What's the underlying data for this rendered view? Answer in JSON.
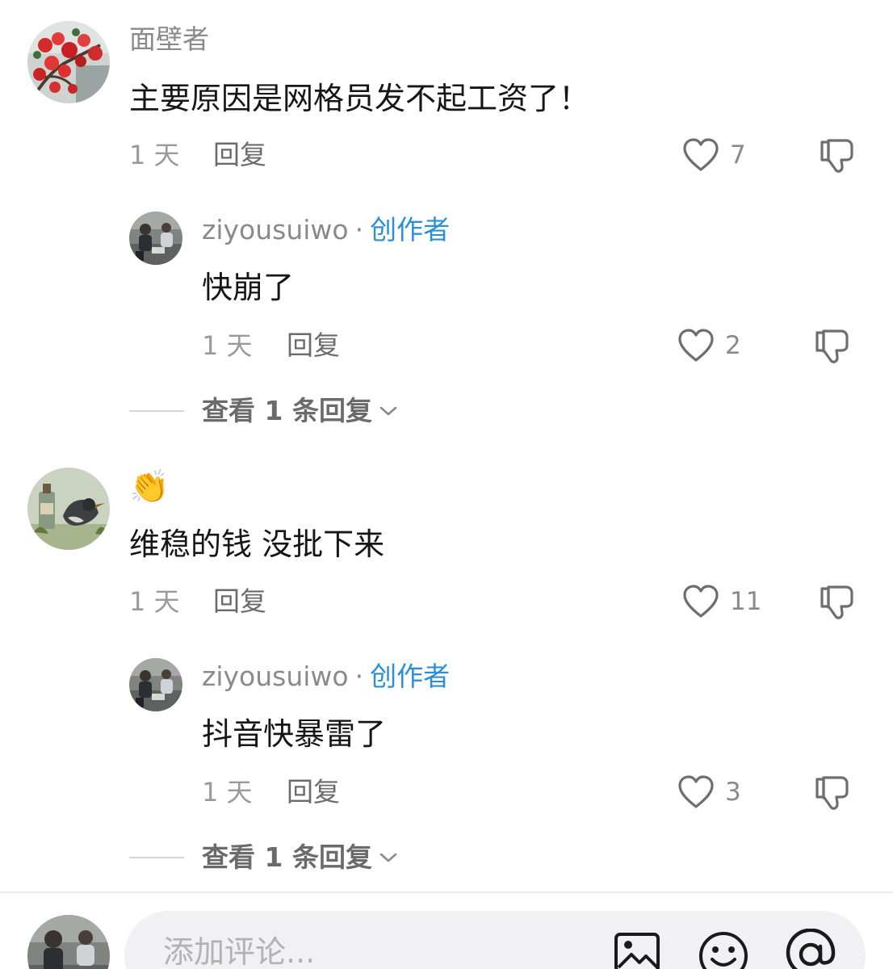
{
  "comments": [
    {
      "username": "面壁者",
      "text": "主要原因是网格员发不起工资了！",
      "time": "1 天",
      "reply_label": "回复",
      "likes": "7",
      "avatar_icon": "red-flowers-avatar",
      "replies": [
        {
          "username": "ziyousuiwo",
          "separator": "·",
          "badge": "创作者",
          "text": "快崩了",
          "time": "1 天",
          "reply_label": "回复",
          "likes": "2",
          "avatar_icon": "people-photo-avatar"
        }
      ],
      "view_replies_label": "查看 1 条回复"
    },
    {
      "username": "👏",
      "text": "维稳的钱 没批下来",
      "time": "1 天",
      "reply_label": "回复",
      "likes": "11",
      "avatar_icon": "bird-bottle-avatar",
      "replies": [
        {
          "username": "ziyousuiwo",
          "separator": "·",
          "badge": "创作者",
          "text": "抖音快暴雷了",
          "time": "1 天",
          "reply_label": "回复",
          "likes": "3",
          "avatar_icon": "people-photo-avatar"
        }
      ],
      "view_replies_label": "查看 1 条回复"
    }
  ],
  "composer": {
    "placeholder": "添加评论...",
    "icons": [
      "image-icon",
      "emoji-icon",
      "mention-icon"
    ]
  },
  "colors": {
    "creator_badge": "#2b8fd8",
    "meta_text": "#9a9a9a",
    "input_bg": "#f1f1f3"
  }
}
